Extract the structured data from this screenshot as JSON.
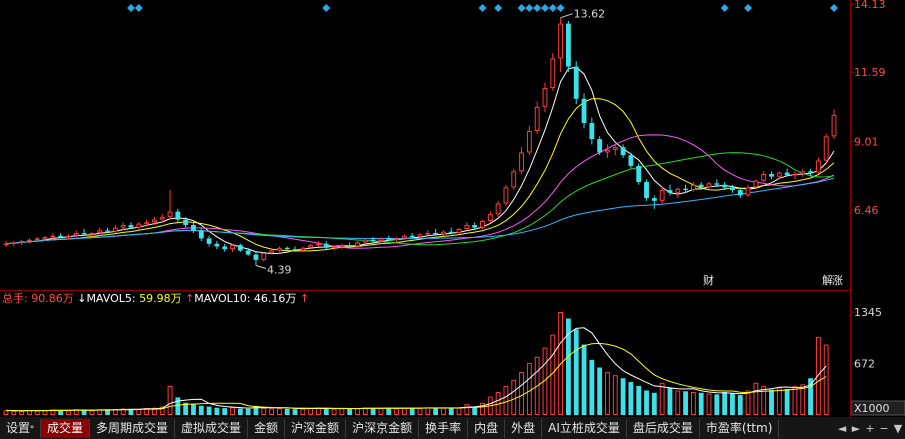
{
  "price_axis": {
    "ticks": [
      "14.13",
      "11.59",
      "9.01",
      "6.46"
    ]
  },
  "price_annotations": {
    "high": "13.62",
    "low": "4.39"
  },
  "event_markers": {
    "cai": "财",
    "jie": "解",
    "zhang": "涨"
  },
  "volume_axis": {
    "ticks": [
      "1345",
      "672"
    ],
    "unit": "X1000"
  },
  "volume_legend": {
    "total": {
      "label": "总手:",
      "value": "90.86万"
    },
    "ma5": {
      "label": "MAVOL5:",
      "value": "59.98万",
      "arrow": "↓"
    },
    "ma10": {
      "label": "MAVOL10:",
      "value": "46.16万",
      "arrow": "↑"
    }
  },
  "tabs": [
    {
      "label": "设置",
      "sup": "*",
      "name": "tab-settings"
    },
    {
      "label": "成交量",
      "active": true,
      "name": "tab-volume"
    },
    {
      "label": "多周期成交量",
      "name": "tab-multi-period-volume"
    },
    {
      "label": "虚拟成交量",
      "name": "tab-virtual-volume"
    },
    {
      "label": "金额",
      "name": "tab-amount"
    },
    {
      "label": "沪深金额",
      "name": "tab-hs-amount"
    },
    {
      "label": "沪深京金额",
      "name": "tab-hsj-amount"
    },
    {
      "label": "换手率",
      "name": "tab-turnover"
    },
    {
      "label": "内盘",
      "name": "tab-inner"
    },
    {
      "label": "外盘",
      "name": "tab-outer"
    },
    {
      "label": "AI立桩成交量",
      "name": "tab-ai-volume"
    },
    {
      "label": "盘后成交量",
      "name": "tab-after-hours-volume"
    },
    {
      "label": "市盈率(ttm)",
      "name": "tab-pe-ttm"
    }
  ],
  "tab_controls": [
    "◄",
    "►",
    "+",
    "−",
    "▼"
  ],
  "colors": {
    "up": "#ff3b3b",
    "down": "#3be0e8",
    "ma5": "#ffffff",
    "ma10": "#ffff00",
    "ma20": "#ff55ff",
    "ma30": "#22dd22",
    "ma60": "#2fb8ff",
    "axis": "#8b0000",
    "label_red": "#ff4a4a",
    "marker_blue": "#2aa8e8"
  },
  "chart_data": [
    {
      "type": "candlestick",
      "price_range": [
        4.0,
        14.13
      ],
      "series_ma": [
        "MA5",
        "MA10",
        "MA20",
        "MA30",
        "MA60"
      ],
      "candles": [
        [
          5.2,
          5.3,
          5.1,
          5.2
        ],
        [
          5.2,
          5.3,
          5.1,
          5.25
        ],
        [
          5.25,
          5.35,
          5.15,
          5.3
        ],
        [
          5.3,
          5.4,
          5.2,
          5.35
        ],
        [
          5.35,
          5.45,
          5.25,
          5.4
        ],
        [
          5.4,
          5.5,
          5.3,
          5.45
        ],
        [
          5.45,
          5.6,
          5.35,
          5.5
        ],
        [
          5.5,
          5.6,
          5.4,
          5.45
        ],
        [
          5.45,
          5.55,
          5.35,
          5.5
        ],
        [
          5.5,
          5.7,
          5.45,
          5.6
        ],
        [
          5.6,
          5.75,
          5.5,
          5.55
        ],
        [
          5.55,
          5.65,
          5.45,
          5.6
        ],
        [
          5.6,
          5.8,
          5.5,
          5.7
        ],
        [
          5.7,
          5.8,
          5.6,
          5.65
        ],
        [
          5.65,
          5.9,
          5.6,
          5.8
        ],
        [
          5.8,
          6.0,
          5.7,
          5.9
        ],
        [
          5.9,
          6.0,
          5.75,
          5.8
        ],
        [
          5.8,
          6.0,
          5.7,
          5.95
        ],
        [
          5.95,
          6.1,
          5.85,
          6.0
        ],
        [
          6.0,
          6.2,
          5.9,
          6.1
        ],
        [
          6.1,
          6.3,
          6.0,
          6.2
        ],
        [
          6.2,
          7.2,
          6.1,
          6.4
        ],
        [
          6.4,
          6.5,
          6.0,
          6.1
        ],
        [
          6.1,
          6.2,
          5.8,
          5.9
        ],
        [
          5.9,
          6.0,
          5.6,
          5.7
        ],
        [
          5.7,
          5.8,
          5.3,
          5.4
        ],
        [
          5.4,
          5.5,
          5.1,
          5.2
        ],
        [
          5.2,
          5.3,
          5.0,
          5.1
        ],
        [
          5.1,
          5.2,
          4.9,
          5.0
        ],
        [
          5.0,
          5.2,
          4.9,
          5.15
        ],
        [
          5.15,
          5.2,
          4.9,
          4.95
        ],
        [
          4.95,
          5.05,
          4.75,
          4.8
        ],
        [
          4.8,
          4.9,
          4.39,
          4.6
        ],
        [
          4.6,
          4.9,
          4.55,
          4.85
        ],
        [
          4.85,
          5.0,
          4.8,
          4.95
        ],
        [
          4.95,
          5.1,
          4.9,
          5.05
        ],
        [
          5.05,
          5.1,
          4.95,
          5.0
        ],
        [
          5.0,
          5.1,
          4.9,
          4.95
        ],
        [
          4.95,
          5.1,
          4.9,
          5.05
        ],
        [
          5.05,
          5.2,
          5.0,
          5.15
        ],
        [
          5.15,
          5.3,
          5.1,
          5.2
        ],
        [
          5.2,
          5.3,
          5.0,
          5.05
        ],
        [
          5.05,
          5.15,
          4.95,
          5.1
        ],
        [
          5.1,
          5.2,
          5.0,
          5.15
        ],
        [
          5.15,
          5.25,
          5.05,
          5.1
        ],
        [
          5.1,
          5.3,
          5.05,
          5.25
        ],
        [
          5.25,
          5.4,
          5.2,
          5.35
        ],
        [
          5.35,
          5.45,
          5.25,
          5.3
        ],
        [
          5.3,
          5.45,
          5.25,
          5.4
        ],
        [
          5.4,
          5.5,
          5.3,
          5.35
        ],
        [
          5.35,
          5.45,
          5.25,
          5.4
        ],
        [
          5.4,
          5.55,
          5.35,
          5.5
        ],
        [
          5.5,
          5.6,
          5.4,
          5.45
        ],
        [
          5.45,
          5.6,
          5.4,
          5.55
        ],
        [
          5.55,
          5.7,
          5.5,
          5.6
        ],
        [
          5.6,
          5.75,
          5.5,
          5.55
        ],
        [
          5.55,
          5.7,
          5.5,
          5.65
        ],
        [
          5.65,
          5.8,
          5.55,
          5.6
        ],
        [
          5.6,
          5.8,
          5.55,
          5.75
        ],
        [
          5.75,
          6.0,
          5.7,
          5.9
        ],
        [
          5.9,
          6.0,
          5.7,
          5.8
        ],
        [
          5.8,
          6.1,
          5.75,
          6.05
        ],
        [
          6.05,
          6.4,
          6.0,
          6.3
        ],
        [
          6.3,
          6.8,
          6.2,
          6.7
        ],
        [
          6.7,
          7.4,
          6.6,
          7.3
        ],
        [
          7.3,
          8.0,
          7.2,
          7.9
        ],
        [
          7.9,
          8.8,
          7.8,
          8.6
        ],
        [
          8.6,
          9.6,
          8.5,
          9.4
        ],
        [
          9.4,
          10.5,
          9.3,
          10.3
        ],
        [
          10.3,
          11.2,
          10.1,
          11.0
        ],
        [
          11.0,
          12.3,
          10.9,
          12.1
        ],
        [
          12.1,
          13.62,
          11.6,
          13.4
        ],
        [
          13.4,
          13.5,
          11.6,
          11.8
        ],
        [
          11.8,
          12.0,
          10.4,
          10.6
        ],
        [
          10.6,
          10.8,
          9.5,
          9.7
        ],
        [
          9.7,
          9.9,
          8.9,
          9.1
        ],
        [
          9.1,
          9.2,
          8.5,
          8.6
        ],
        [
          8.6,
          8.9,
          8.4,
          8.7
        ],
        [
          8.7,
          8.9,
          8.5,
          8.8
        ],
        [
          8.8,
          8.9,
          8.4,
          8.5
        ],
        [
          8.5,
          8.6,
          8.0,
          8.1
        ],
        [
          8.1,
          8.2,
          7.4,
          7.5
        ],
        [
          7.5,
          7.6,
          6.8,
          6.9
        ],
        [
          6.9,
          7.0,
          6.5,
          6.8
        ],
        [
          6.8,
          7.3,
          6.7,
          7.2
        ],
        [
          7.2,
          7.4,
          7.0,
          7.1
        ],
        [
          7.1,
          7.3,
          6.9,
          7.25
        ],
        [
          7.25,
          7.4,
          7.1,
          7.2
        ],
        [
          7.2,
          7.5,
          7.15,
          7.4
        ],
        [
          7.4,
          7.5,
          7.2,
          7.3
        ],
        [
          7.3,
          7.5,
          7.25,
          7.45
        ],
        [
          7.45,
          7.6,
          7.3,
          7.4
        ],
        [
          7.4,
          7.5,
          7.2,
          7.3
        ],
        [
          7.3,
          7.4,
          7.1,
          7.2
        ],
        [
          7.2,
          7.3,
          6.9,
          7.0
        ],
        [
          7.0,
          7.4,
          6.95,
          7.3
        ],
        [
          7.3,
          7.6,
          7.25,
          7.55
        ],
        [
          7.55,
          7.9,
          7.5,
          7.8
        ],
        [
          7.8,
          7.9,
          7.6,
          7.7
        ],
        [
          7.7,
          7.9,
          7.6,
          7.85
        ],
        [
          7.85,
          8.0,
          7.7,
          7.75
        ],
        [
          7.75,
          7.9,
          7.6,
          7.8
        ],
        [
          7.8,
          8.0,
          7.7,
          7.9
        ],
        [
          7.9,
          8.0,
          7.7,
          7.85
        ],
        [
          7.85,
          8.4,
          7.8,
          8.3
        ],
        [
          8.3,
          9.3,
          8.2,
          9.2
        ],
        [
          9.2,
          10.2,
          9.1,
          10.0
        ]
      ]
    },
    {
      "type": "bar",
      "name": "成交量",
      "unit": "X1000",
      "volume_range": [
        0,
        1345
      ],
      "series_ma": [
        "MAVOL5",
        "MAVOL10"
      ],
      "values": [
        60,
        55,
        50,
        65,
        58,
        62,
        70,
        55,
        60,
        75,
        68,
        60,
        72,
        65,
        78,
        85,
        70,
        80,
        90,
        95,
        110,
        380,
        230,
        160,
        140,
        120,
        110,
        95,
        90,
        100,
        85,
        80,
        120,
        95,
        88,
        92,
        80,
        76,
        85,
        90,
        95,
        78,
        82,
        88,
        80,
        90,
        95,
        88,
        92,
        85,
        90,
        95,
        88,
        92,
        98,
        90,
        95,
        88,
        96,
        140,
        110,
        160,
        240,
        300,
        380,
        460,
        560,
        680,
        760,
        880,
        1050,
        1345,
        1260,
        1120,
        920,
        720,
        620,
        560,
        520,
        480,
        430,
        380,
        320,
        290,
        420,
        360,
        320,
        310,
        300,
        290,
        280,
        270,
        300,
        280,
        260,
        320,
        420,
        380,
        330,
        360,
        340,
        380,
        400,
        480,
        1020,
        920
      ]
    }
  ]
}
